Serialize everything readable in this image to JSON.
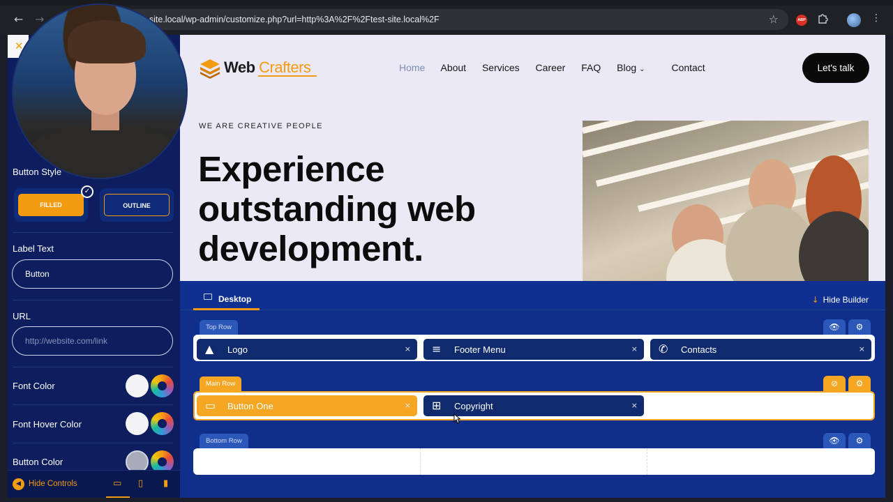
{
  "browser": {
    "url": "st-site.local/wp-admin/customize.php?url=http%3A%2F%2Ftest-site.local%2F",
    "back_icon": "arrow-left-icon",
    "forward_icon": "arrow-right-icon",
    "star_icon": "star-icon",
    "abp_label": "ABP",
    "extensions_icon": "puzzle-icon",
    "menu_icon": "kebab-icon"
  },
  "panel": {
    "close_icon": "close-icon",
    "button_style_label": "Button Style",
    "filled_label": "FILLED",
    "outline_label": "OUTLINE",
    "label_text_label": "Label Text",
    "label_text_value": "Button",
    "url_label": "URL",
    "url_placeholder": "http://website.com/link",
    "font_color_label": "Font Color",
    "font_hover_color_label": "Font Hover Color",
    "button_color_label": "Button Color",
    "hide_controls_label": "Hide Controls",
    "accent": "#f39c12",
    "bg": "#0d1d5e"
  },
  "site": {
    "logo_main": "Web",
    "logo_accent": "Crafters",
    "nav": [
      "Home",
      "About",
      "Services",
      "Career",
      "FAQ",
      "Blog",
      "Contact"
    ],
    "blog_caret": "⌄",
    "cta": "Let's talk",
    "eyebrow": "WE ARE CREATIVE PEOPLE",
    "headline": "Experience outstanding web development."
  },
  "builder": {
    "desktop_tab": "Desktop",
    "hide_builder": "Hide Builder",
    "top_row": {
      "label": "Top Row",
      "items": [
        {
          "label": "Logo",
          "icon": "logo-mountain-icon"
        },
        {
          "label": "Footer Menu",
          "icon": "menu-lines-icon"
        },
        {
          "label": "Contacts",
          "icon": "phone-icon"
        }
      ]
    },
    "main_row": {
      "label": "Main Row",
      "items": [
        {
          "label": "Button One",
          "icon": "button-icon"
        },
        {
          "label": "Copyright",
          "icon": "grid-icon"
        }
      ]
    },
    "bottom_row": {
      "label": "Bottom Row"
    },
    "remove_glyph": "×"
  }
}
